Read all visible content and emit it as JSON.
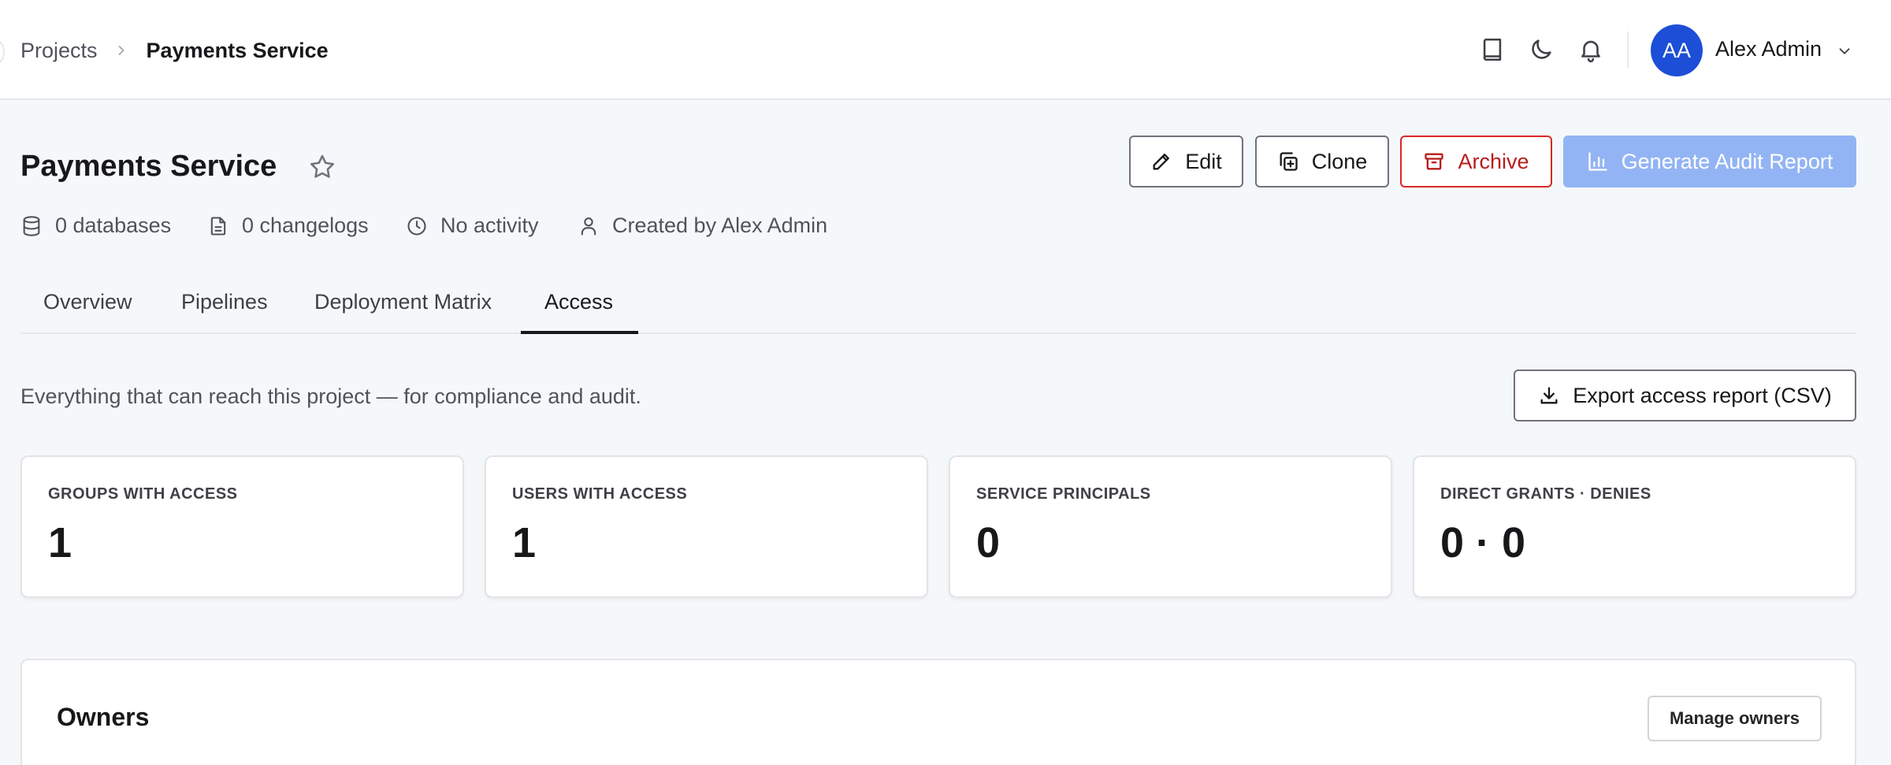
{
  "breadcrumb": {
    "parent": "Projects",
    "current": "Payments Service"
  },
  "header": {
    "icons": [
      "book-icon",
      "moon-icon",
      "bell-icon"
    ],
    "user": {
      "initials": "AA",
      "name": "Alex Admin"
    }
  },
  "project": {
    "title": "Payments Service",
    "meta": {
      "databases": "0 databases",
      "changelogs": "0 changelogs",
      "activity": "No activity",
      "created_by": "Created by Alex Admin"
    }
  },
  "actions": {
    "edit": "Edit",
    "clone": "Clone",
    "archive": "Archive",
    "audit": "Generate Audit Report"
  },
  "tabs": [
    {
      "label": "Overview"
    },
    {
      "label": "Pipelines"
    },
    {
      "label": "Deployment Matrix"
    },
    {
      "label": "Access",
      "active": true
    }
  ],
  "access": {
    "subtitle": "Everything that can reach this project — for compliance and audit.",
    "export_label": "Export access report (CSV)",
    "stats": [
      {
        "label": "GROUPS WITH ACCESS",
        "value": "1"
      },
      {
        "label": "USERS WITH ACCESS",
        "value": "1"
      },
      {
        "label": "SERVICE PRINCIPALS",
        "value": "0"
      },
      {
        "label": "DIRECT GRANTS · DENIES",
        "value": "0 · 0"
      }
    ]
  },
  "owners": {
    "title": "Owners",
    "manage_label": "Manage owners"
  },
  "colors": {
    "accent": "#1d4ed8",
    "audit_button": "#93b4f4",
    "archive": "#dc2626",
    "background": "#f5f8fb"
  }
}
